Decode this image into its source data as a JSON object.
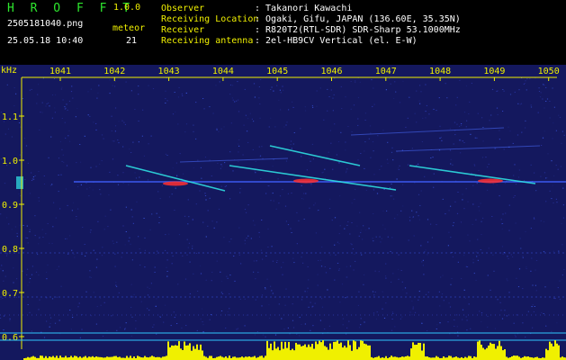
{
  "app": {
    "title": "H R O F F T",
    "version": "1.0.0",
    "filename": "2505181040.png",
    "datetime": "25.05.18 10:40",
    "meteor_label": "meteor",
    "meteor_count": "21"
  },
  "info": [
    {
      "label": "Observer",
      "value": ": Takanori Kawachi"
    },
    {
      "label": "Receiving Location",
      "value": ": Ogaki, Gifu, JAPAN (136.60E, 35.35N)"
    },
    {
      "label": "Receiver",
      "value": ": R820T2(RTL-SDR) SDR-Sharp 53.1000MHz"
    },
    {
      "label": "Receiving antenna",
      "value": ": 2el-HB9CV Vertical (el. E-W)"
    }
  ],
  "spectrogram": {
    "unit_label": "kHz",
    "hz_ticks": [
      "1041",
      "1042",
      "1043",
      "1044",
      "1045",
      "1046",
      "1047",
      "1048",
      "1049",
      "1050"
    ],
    "khz_ticks": [
      "1.1",
      "1.0",
      "0.9",
      "0.8",
      "0.7",
      "0.6"
    ],
    "colors": {
      "background": "#14185e",
      "axis": "#f0f000",
      "signal_hot": "#ff3030",
      "signal_mid": "#30e8e8",
      "baseline": "#4060ff",
      "bars": "#f0f000",
      "cyan_line": "#30c8ff"
    }
  }
}
